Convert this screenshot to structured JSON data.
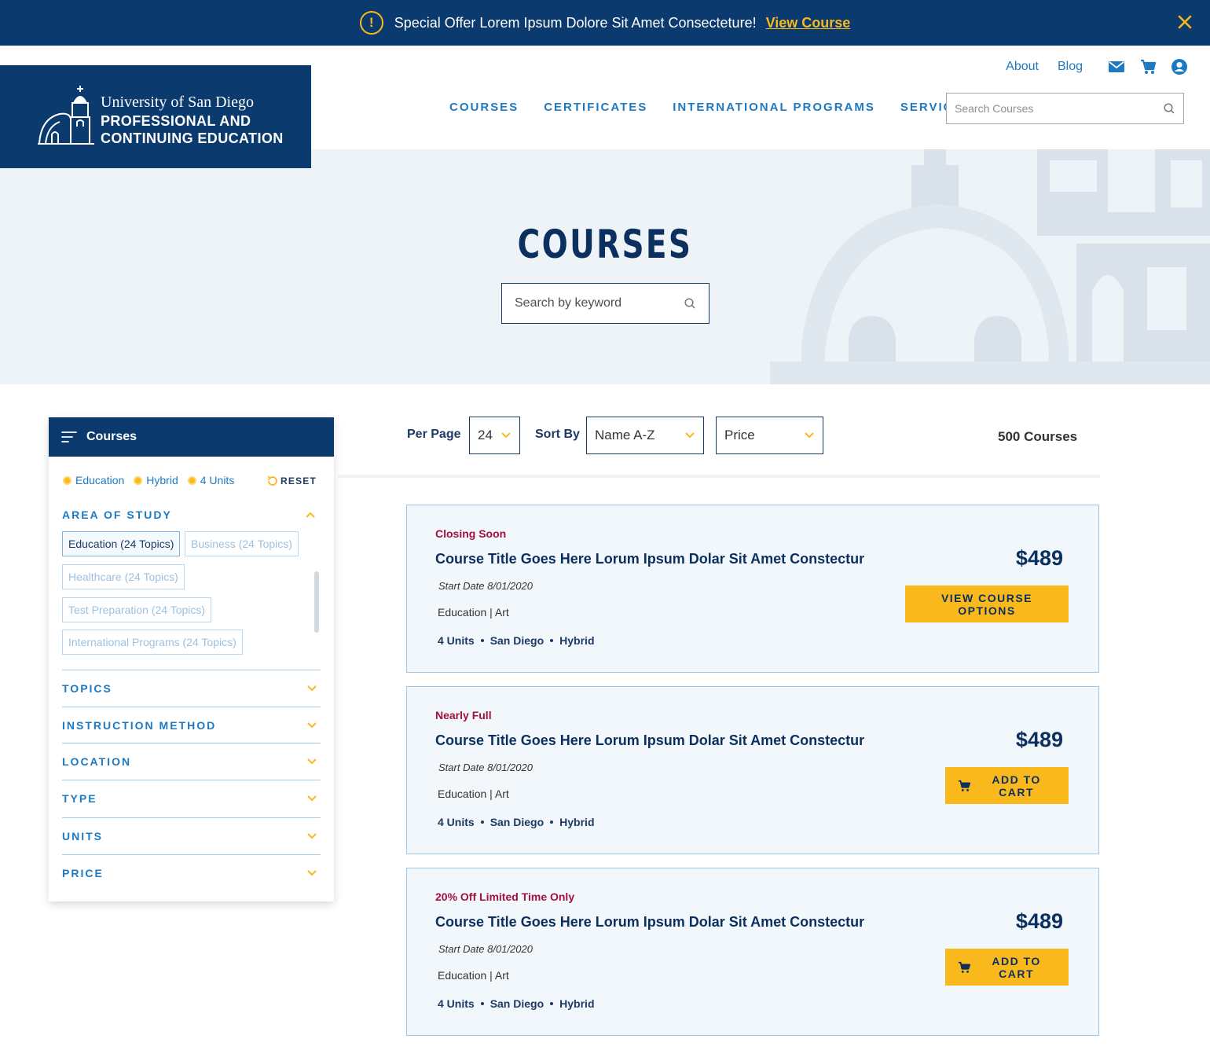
{
  "promo": {
    "text": "Special Offer Lorem Ipsum Dolore Sit Amet Consecteture!",
    "link": "View Course",
    "alert_symbol": "!"
  },
  "logo": {
    "line1": "University of San Diego",
    "line2": "PROFESSIONAL AND",
    "line3": "CONTINUING EDUCATION"
  },
  "util_nav": {
    "about": "About",
    "blog": "Blog"
  },
  "main_nav": [
    "COURSES",
    "CERTIFICATES",
    "INTERNATIONAL PROGRAMS",
    "SERVICES"
  ],
  "header_search": {
    "placeholder": "Search Courses"
  },
  "hero": {
    "title": "COURSES",
    "search_placeholder": "Search by keyword"
  },
  "sidebar": {
    "title": "Courses",
    "active_filters": [
      "Education",
      "Hybrid",
      "4 Units"
    ],
    "reset": "RESET",
    "area_of_study": {
      "title": "AREA OF STUDY",
      "topics": [
        "Education (24 Topics)",
        "Business (24 Topics)",
        "Healthcare (24 Topics)",
        "Test Preparation (24 Topics)",
        "International Programs (24 Topics)"
      ]
    },
    "sections": [
      "TOPICS",
      "INSTRUCTION METHOD",
      "LOCATION",
      "TYPE",
      "UNITS",
      "PRICE"
    ]
  },
  "toolbar": {
    "per_page_label": "Per Page",
    "per_page_value": "24",
    "sort_label": "Sort By",
    "sort_value": "Name A-Z",
    "price_value": "Price",
    "count": "500 Courses"
  },
  "courses": [
    {
      "status": "Closing Soon",
      "title": "Course Title Goes Here Lorum Ipsum Dolar Sit Amet Constectur",
      "date": "Start Date 8/01/2020",
      "category": "Education | Art",
      "units": "4 Units",
      "location": "San Diego",
      "method": "Hybrid",
      "price": "$489",
      "button": "VIEW COURSE OPTIONS"
    },
    {
      "status": "Nearly Full",
      "title": "Course Title Goes Here Lorum Ipsum Dolar Sit Amet Constectur",
      "date": "Start Date 8/01/2020",
      "category": "Education | Art",
      "units": "4 Units",
      "location": "San Diego",
      "method": "Hybrid",
      "price": "$489",
      "button": "ADD TO CART"
    },
    {
      "status": "20% Off Limited Time Only",
      "title": "Course Title Goes Here Lorum Ipsum Dolar Sit Amet Constectur",
      "date": "Start Date 8/01/2020",
      "category": "Education | Art",
      "units": "4 Units",
      "location": "San Diego",
      "method": "Hybrid",
      "price": "$489",
      "button": "ADD TO CART"
    }
  ],
  "colors": {
    "navy": "#0b3a6e",
    "accent_yellow": "#f9b91c",
    "link_blue": "#1d7ac2",
    "status_red": "#a0113b",
    "hero_bg": "#eef3f8"
  }
}
